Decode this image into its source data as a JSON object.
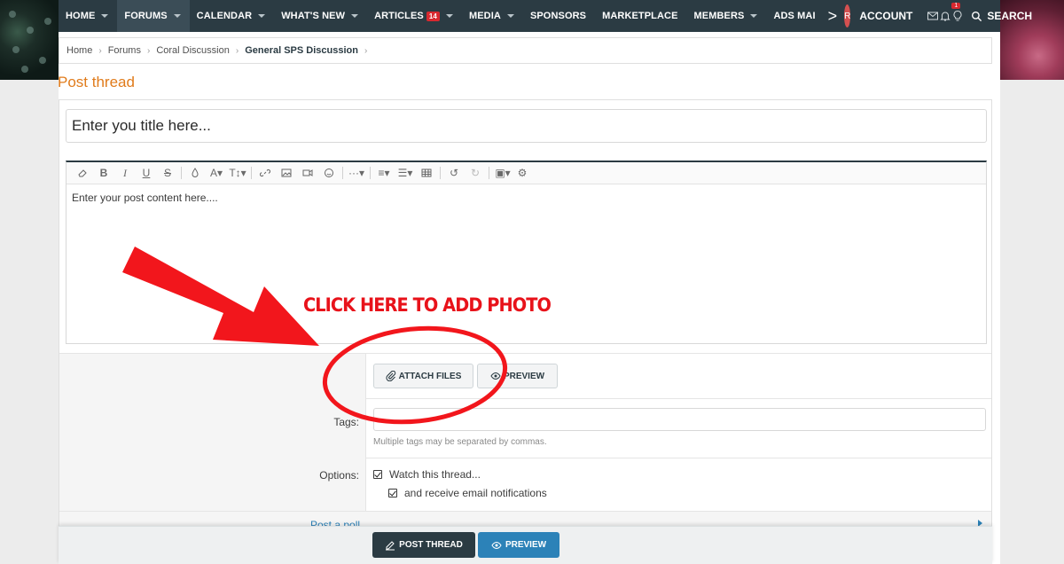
{
  "nav": {
    "items": [
      {
        "label": "HOME",
        "caret": true
      },
      {
        "label": "FORUMS",
        "caret": true,
        "active": true
      },
      {
        "label": "CALENDAR",
        "caret": true
      },
      {
        "label": "WHAT'S NEW",
        "caret": true
      },
      {
        "label": "ARTICLES",
        "badge": "14",
        "caret": true
      },
      {
        "label": "MEDIA",
        "caret": true
      },
      {
        "label": "SPONSORS",
        "caret": false
      },
      {
        "label": "MARKETPLACE",
        "caret": false
      },
      {
        "label": "MEMBERS",
        "caret": true
      },
      {
        "label": "ADS MAI",
        "caret": false
      }
    ],
    "more": ">",
    "avatar_initial": "R",
    "account_label": "ACCOUNT",
    "alerts_badge": "1",
    "search_label": "SEARCH"
  },
  "breadcrumb": [
    "Home",
    "Forums",
    "Coral Discussion",
    "General SPS Discussion"
  ],
  "page_title": "Post thread",
  "form": {
    "title_placeholder": "Enter you title here...",
    "content_placeholder": "Enter your post content here....",
    "attach_label": "ATTACH FILES",
    "preview_label": "PREVIEW",
    "tags_label": "Tags:",
    "tags_hint": "Multiple tags may be separated by commas.",
    "options_label": "Options:",
    "watch_label": "Watch this thread...",
    "email_label": "and receive email notifications",
    "poll_label": "Post a poll",
    "post_label": "POST THREAD",
    "footer_preview_label": "PREVIEW"
  },
  "annotation": {
    "text": "CLICK HERE TO ADD PHOTO",
    "color": "#e8121a"
  },
  "colors": {
    "nav_bg": "#2b3b43",
    "title_orange": "#e07b1b",
    "link_blue": "#2c82b8"
  }
}
